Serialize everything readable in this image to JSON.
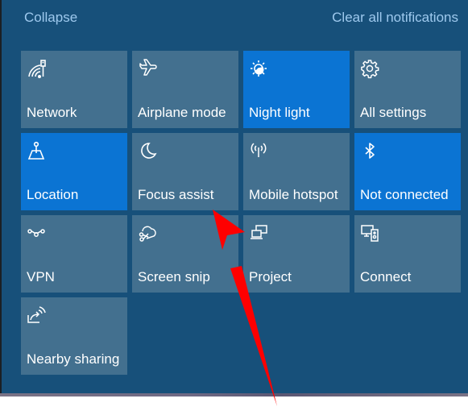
{
  "header": {
    "collapse_label": "Collapse",
    "clear_label": "Clear all notifications"
  },
  "tiles": [
    {
      "label": "Network",
      "icon": "network-icon",
      "active": false
    },
    {
      "label": "Airplane mode",
      "icon": "airplane-icon",
      "active": false
    },
    {
      "label": "Night light",
      "icon": "night-light-icon",
      "active": true
    },
    {
      "label": "All settings",
      "icon": "gear-icon",
      "active": false
    },
    {
      "label": "Location",
      "icon": "location-icon",
      "active": true
    },
    {
      "label": "Focus assist",
      "icon": "moon-icon",
      "active": false
    },
    {
      "label": "Mobile hotspot",
      "icon": "hotspot-icon",
      "active": false
    },
    {
      "label": "Not connected",
      "icon": "bluetooth-icon",
      "active": true
    },
    {
      "label": "VPN",
      "icon": "vpn-icon",
      "active": false
    },
    {
      "label": "Screen snip",
      "icon": "screen-snip-icon",
      "active": false
    },
    {
      "label": "Project",
      "icon": "project-icon",
      "active": false
    },
    {
      "label": "Connect",
      "icon": "connect-icon",
      "active": false
    },
    {
      "label": "Nearby sharing",
      "icon": "nearby-sharing-icon",
      "active": false
    }
  ],
  "colors": {
    "panel_bg": "#17507a",
    "tile_bg": "#43708f",
    "tile_active_bg": "#0b74d3",
    "link_text": "#9ec9ee",
    "annotation_arrow": "#ff0000"
  },
  "annotation": {
    "type": "arrow",
    "points_to": "Focus assist"
  }
}
